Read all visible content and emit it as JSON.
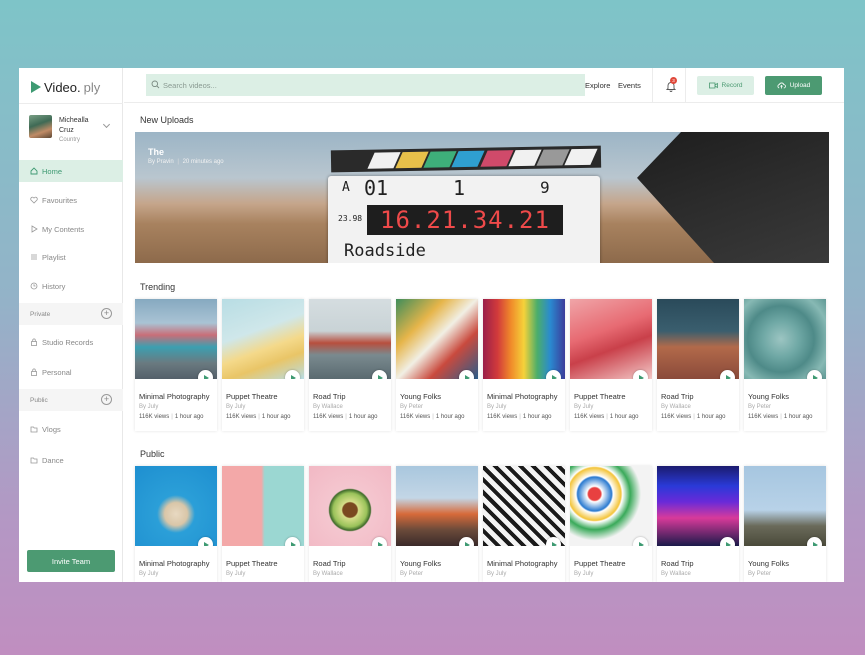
{
  "app": {
    "logo_text": "Video.",
    "logo_sub": "ply"
  },
  "profile": {
    "name": "Michealla Cruz",
    "country": "Country"
  },
  "nav": {
    "home": "Home",
    "favourites": "Favourites",
    "my_contents": "My Contents",
    "playlist": "Playlist",
    "history": "History",
    "private_label": "Private",
    "studio_records": "Studio Records",
    "personal": "Personal",
    "public_label": "Public",
    "vlogs": "Vlogs",
    "dance": "Dance",
    "invite_team": "Invite Team"
  },
  "topbar": {
    "search_placeholder": "Search videos...",
    "explore": "Explore",
    "events": "Events",
    "notification_count": "3",
    "record": "Record",
    "upload": "Upload"
  },
  "hero": {
    "section_title": "New Uploads",
    "title": "The",
    "author": "By Pravin",
    "time": "20 minutes ago",
    "led_text": "16.21.34.21",
    "board_roll": "A",
    "board_scene": "01",
    "board_take": "1",
    "board_nine": "9",
    "board_fps": "23.98",
    "board_title": "Roadside"
  },
  "trending": {
    "section_title": "Trending",
    "cards": [
      {
        "title": "Minimal Photography",
        "by": "By July",
        "views": "116K views",
        "time": "1 hour ago",
        "thumb": "train"
      },
      {
        "title": "Puppet Theatre",
        "by": "By July",
        "views": "116K views",
        "time": "1 hour ago",
        "thumb": "leaves"
      },
      {
        "title": "Road Trip",
        "by": "By Wallace",
        "views": "116K views",
        "time": "1 hour ago",
        "thumb": "canal"
      },
      {
        "title": "Young Folks",
        "by": "By Peter",
        "views": "116K views",
        "time": "1 hour ago",
        "thumb": "mural"
      },
      {
        "title": "Minimal Photography",
        "by": "By July",
        "views": "116K views",
        "time": "1 hour ago",
        "thumb": "rainbow"
      },
      {
        "title": "Puppet Theatre",
        "by": "By July",
        "views": "116K views",
        "time": "1 hour ago",
        "thumb": "pinkwall"
      },
      {
        "title": "Road Trip",
        "by": "By Wallace",
        "views": "116K views",
        "time": "1 hour ago",
        "thumb": "building"
      },
      {
        "title": "Young Folks",
        "by": "By Peter",
        "views": "116K views",
        "time": "1 hour ago",
        "thumb": "succulent"
      }
    ]
  },
  "public": {
    "section_title": "Public",
    "cards": [
      {
        "title": "Minimal Photography",
        "by": "By July",
        "thumb": "pineapple"
      },
      {
        "title": "Puppet Theatre",
        "by": "By July",
        "thumb": "clock"
      },
      {
        "title": "Road Trip",
        "by": "By Wallace",
        "thumb": "avocado"
      },
      {
        "title": "Young Folks",
        "by": "By Peter",
        "thumb": "carousel"
      },
      {
        "title": "Minimal Photography",
        "by": "By July",
        "thumb": "troopers"
      },
      {
        "title": "Puppet Theatre",
        "by": "By July",
        "thumb": "paint"
      },
      {
        "title": "Road Trip",
        "by": "By Wallace",
        "thumb": "neon"
      },
      {
        "title": "Young Folks",
        "by": "By Peter",
        "thumb": "palms"
      }
    ]
  },
  "colors": {
    "accent": "#4c9a72",
    "accent_light": "#dcefe5",
    "badge": "#e0483a"
  }
}
